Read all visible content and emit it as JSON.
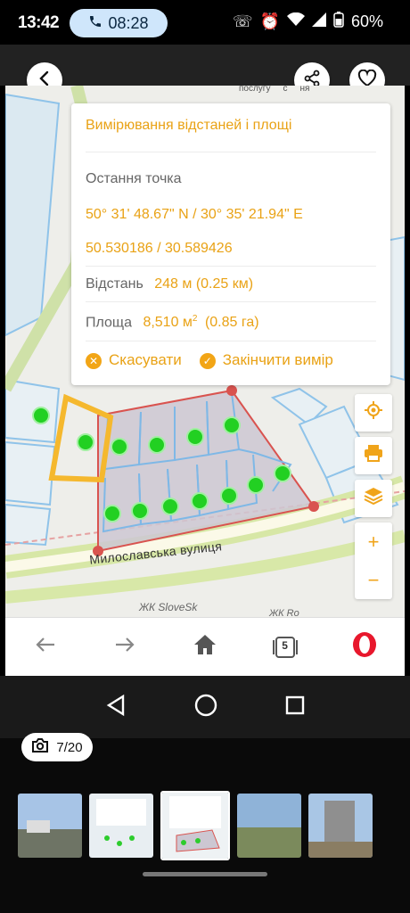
{
  "status": {
    "time": "13:42",
    "call_time": "08:28",
    "battery": "60%"
  },
  "panel": {
    "title": "Вимірювання відстаней і площі",
    "last_point_label": "Остання точка",
    "coords_dms": "50° 31' 48.67\" N / 30° 35' 21.94\" E",
    "coords_dec": "50.530186 / 30.589426",
    "distance_label": "Відстань",
    "distance_value": "248 м (0.25 км)",
    "area_label": "Площа",
    "area_value": "8,510 м",
    "area_sup": "2",
    "area_value_ha": "(0.85 га)",
    "cancel": "Скасувати",
    "finish": "Закінчити вимір"
  },
  "map": {
    "top_links": [
      "послугу",
      "с",
      "ня"
    ],
    "street": "Милославська вулиця",
    "label1": "ЖК SloveSk",
    "label2": "ЖК Ro"
  },
  "toolbar": {
    "tabs_count": "5"
  },
  "gallery": {
    "counter": "7/20"
  },
  "colors": {
    "accent": "#e9a215",
    "measure_line": "#d9534f",
    "plot_dot": "#2dcc2d"
  }
}
